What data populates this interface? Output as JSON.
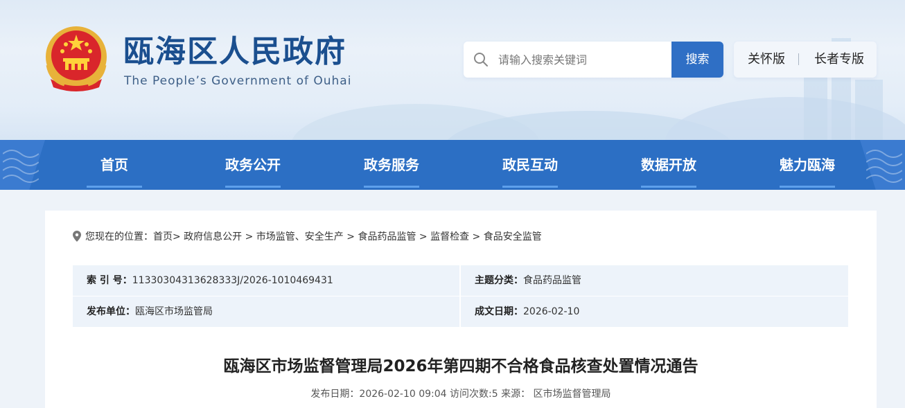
{
  "header": {
    "title": "瓯海区人民政府",
    "subtitle": "The People’s Government of Ouhai"
  },
  "search": {
    "placeholder": "请输入搜索关键词",
    "button_label": "搜索"
  },
  "modes": {
    "care_label": "关怀版",
    "separator": "|",
    "elder_label": "长者专版"
  },
  "nav": {
    "items": [
      {
        "label": "首页"
      },
      {
        "label": "政务公开"
      },
      {
        "label": "政务服务"
      },
      {
        "label": "政民互动"
      },
      {
        "label": "数据开放"
      },
      {
        "label": "魅力瓯海"
      }
    ]
  },
  "breadcrumb": {
    "prefix": "您现在的位置：",
    "path": "首页> 政府信息公开 > 市场监管、安全生产 > 食品药品监管 > 监督检查 > 食品安全监管"
  },
  "meta": {
    "index_label": "索 引 号：",
    "index_value": "11330304313628333J/2026-1010469431",
    "topic_label": "主题分类：",
    "topic_value": "食品药品监管",
    "publisher_label": "发布单位：",
    "publisher_value": "瓯海区市场监管局",
    "date_label": "成文日期：",
    "date_value": "2026-02-10"
  },
  "article": {
    "title": "瓯海区市场监督管理局2026年第四期不合格食品核查处置情况通告",
    "info": "发布日期：2026-02-10 09:04 访问次数:5 来源： 区市场监督管理局"
  },
  "colors": {
    "nav_bg": "#2c6fc4",
    "accent": "#2f6fc5",
    "title_blue": "#1b4f8f",
    "page_bg": "#eef3f9",
    "meta_bg": "#edf3fa"
  },
  "icons": {
    "emblem": "national-emblem-icon",
    "search": "search-icon",
    "location": "location-pin-icon"
  }
}
